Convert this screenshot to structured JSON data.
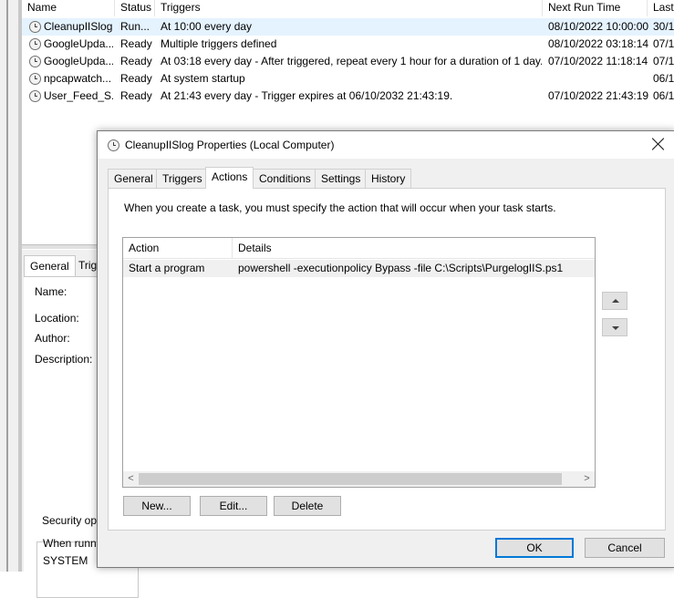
{
  "task_list": {
    "columns": [
      "Name",
      "Status",
      "Triggers",
      "Next Run Time",
      "Last"
    ],
    "rows": [
      {
        "name": "CleanupIISlog",
        "status": "Run...",
        "triggers": "At 10:00 every day",
        "next_run": "08/10/2022 10:00:00",
        "last": "30/1",
        "icon": "clock-icon"
      },
      {
        "name": "GoogleUpda...",
        "status": "Ready",
        "triggers": "Multiple triggers defined",
        "next_run": "08/10/2022 03:18:14",
        "last": "07/1",
        "icon": "clock-icon"
      },
      {
        "name": "GoogleUpda...",
        "status": "Ready",
        "triggers": "At 03:18 every day - After triggered, repeat every 1 hour for a duration of 1 day.",
        "next_run": "07/10/2022 11:18:14",
        "last": "07/1",
        "icon": "clock-icon"
      },
      {
        "name": "npcapwatch...",
        "status": "Ready",
        "triggers": "At system startup",
        "next_run": "",
        "last": "06/1",
        "icon": "clock-icon"
      },
      {
        "name": "User_Feed_S...",
        "status": "Ready",
        "triggers": "At 21:43 every day - Trigger expires at 06/10/2032 21:43:19.",
        "next_run": "07/10/2022 21:43:19",
        "last": "06/1",
        "icon": "clock-icon"
      }
    ]
  },
  "lower_pane": {
    "tabs": [
      "General",
      "Trig"
    ],
    "labels": {
      "name": "Name:",
      "location": "Location:",
      "author": "Author:",
      "description": "Description:",
      "security_options": "Security opt",
      "when_running": "When runn",
      "account": "SYSTEM"
    }
  },
  "dialog": {
    "title": "CleanupIISlog Properties (Local Computer)",
    "tabs": [
      "General",
      "Triggers",
      "Actions",
      "Conditions",
      "Settings",
      "History"
    ],
    "active_tab": "Actions",
    "description": "When you create a task, you must specify the action that will occur when your task starts.",
    "grid": {
      "columns": [
        "Action",
        "Details"
      ],
      "rows": [
        {
          "action": "Start a program",
          "details": "powershell -executionpolicy Bypass -file C:\\Scripts\\PurgelogIIS.ps1"
        }
      ]
    },
    "buttons": {
      "new": "New...",
      "edit": "Edit...",
      "delete": "Delete",
      "ok": "OK",
      "cancel": "Cancel"
    },
    "scroll_left": "<",
    "scroll_right": ">"
  }
}
